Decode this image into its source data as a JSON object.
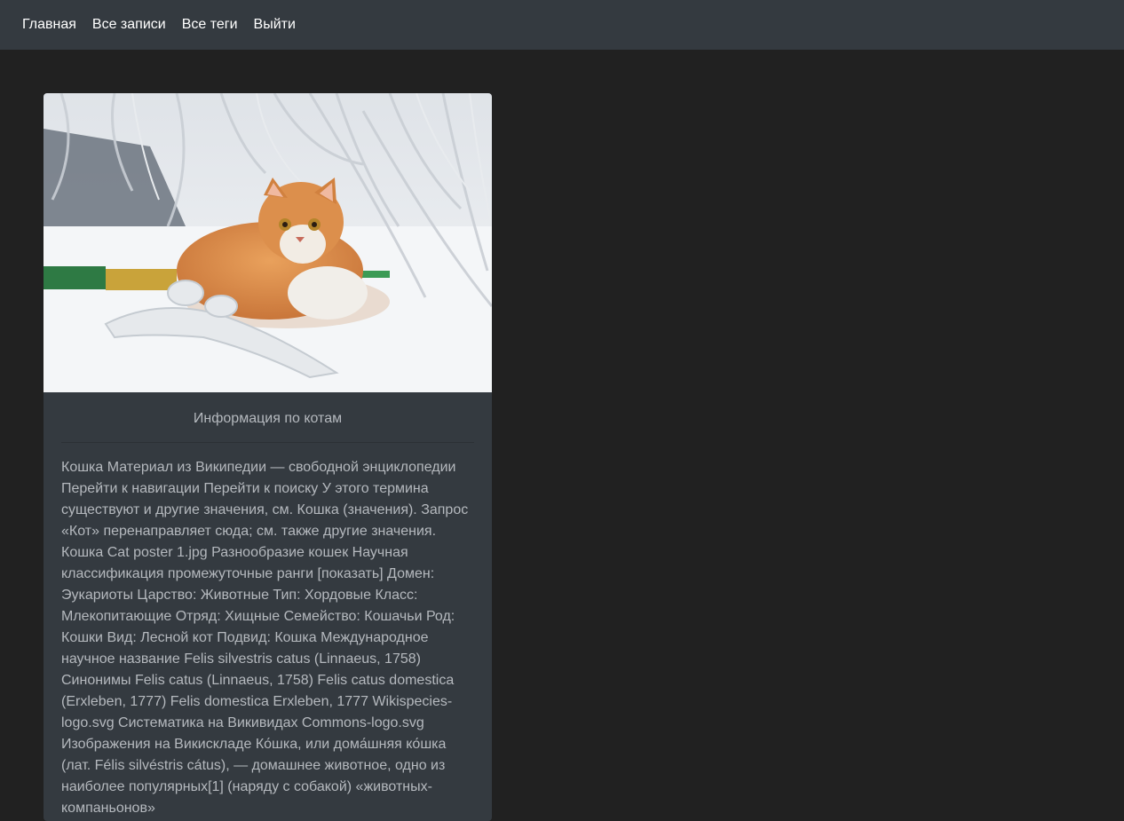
{
  "nav": {
    "items": [
      {
        "label": "Главная"
      },
      {
        "label": "Все записи"
      },
      {
        "label": "Все теги"
      },
      {
        "label": "Выйти"
      }
    ]
  },
  "card": {
    "image_alt": "orange cat sitting in snow under icy branches",
    "title": "Информация по котам",
    "text": "Кошка Материал из Википедии — свободной энциклопедии Перейти к навигации Перейти к поиску У этого термина существуют и другие значения, см. Кошка (значения). Запрос «Кот» перенаправляет сюда; см. также другие значения. Кошка Cat poster 1.jpg Разнообразие кошек Научная классификация промежуточные ранги [показать] Домен: Эукариоты Царство: Животные Тип: Хордовые Класс: Млекопитающие Отряд: Хищные Семейство: Кошачьи Род: Кошки Вид: Лесной кот Подвид: Кошка Международное научное название Felis silvestris catus (Linnaeus, 1758) Синонимы Felis catus (Linnaeus, 1758) Felis catus domestica (Erxleben, 1777) Felis domestica Erxleben, 1777 Wikispecies-logo.svg Систематика на Викивидах Commons-logo.svg Изображения на Викискладе Ко́шка, или дома́шняя ко́шка (лат. Félis silvéstris cátus), — домашнее животное, одно из наиболее популярных[1] (наряду с собакой) «животных-компаньонов»"
  },
  "colors": {
    "background": "#212121",
    "navbar": "#343a40",
    "card": "#343a40",
    "muted_text": "#b5b9be"
  }
}
